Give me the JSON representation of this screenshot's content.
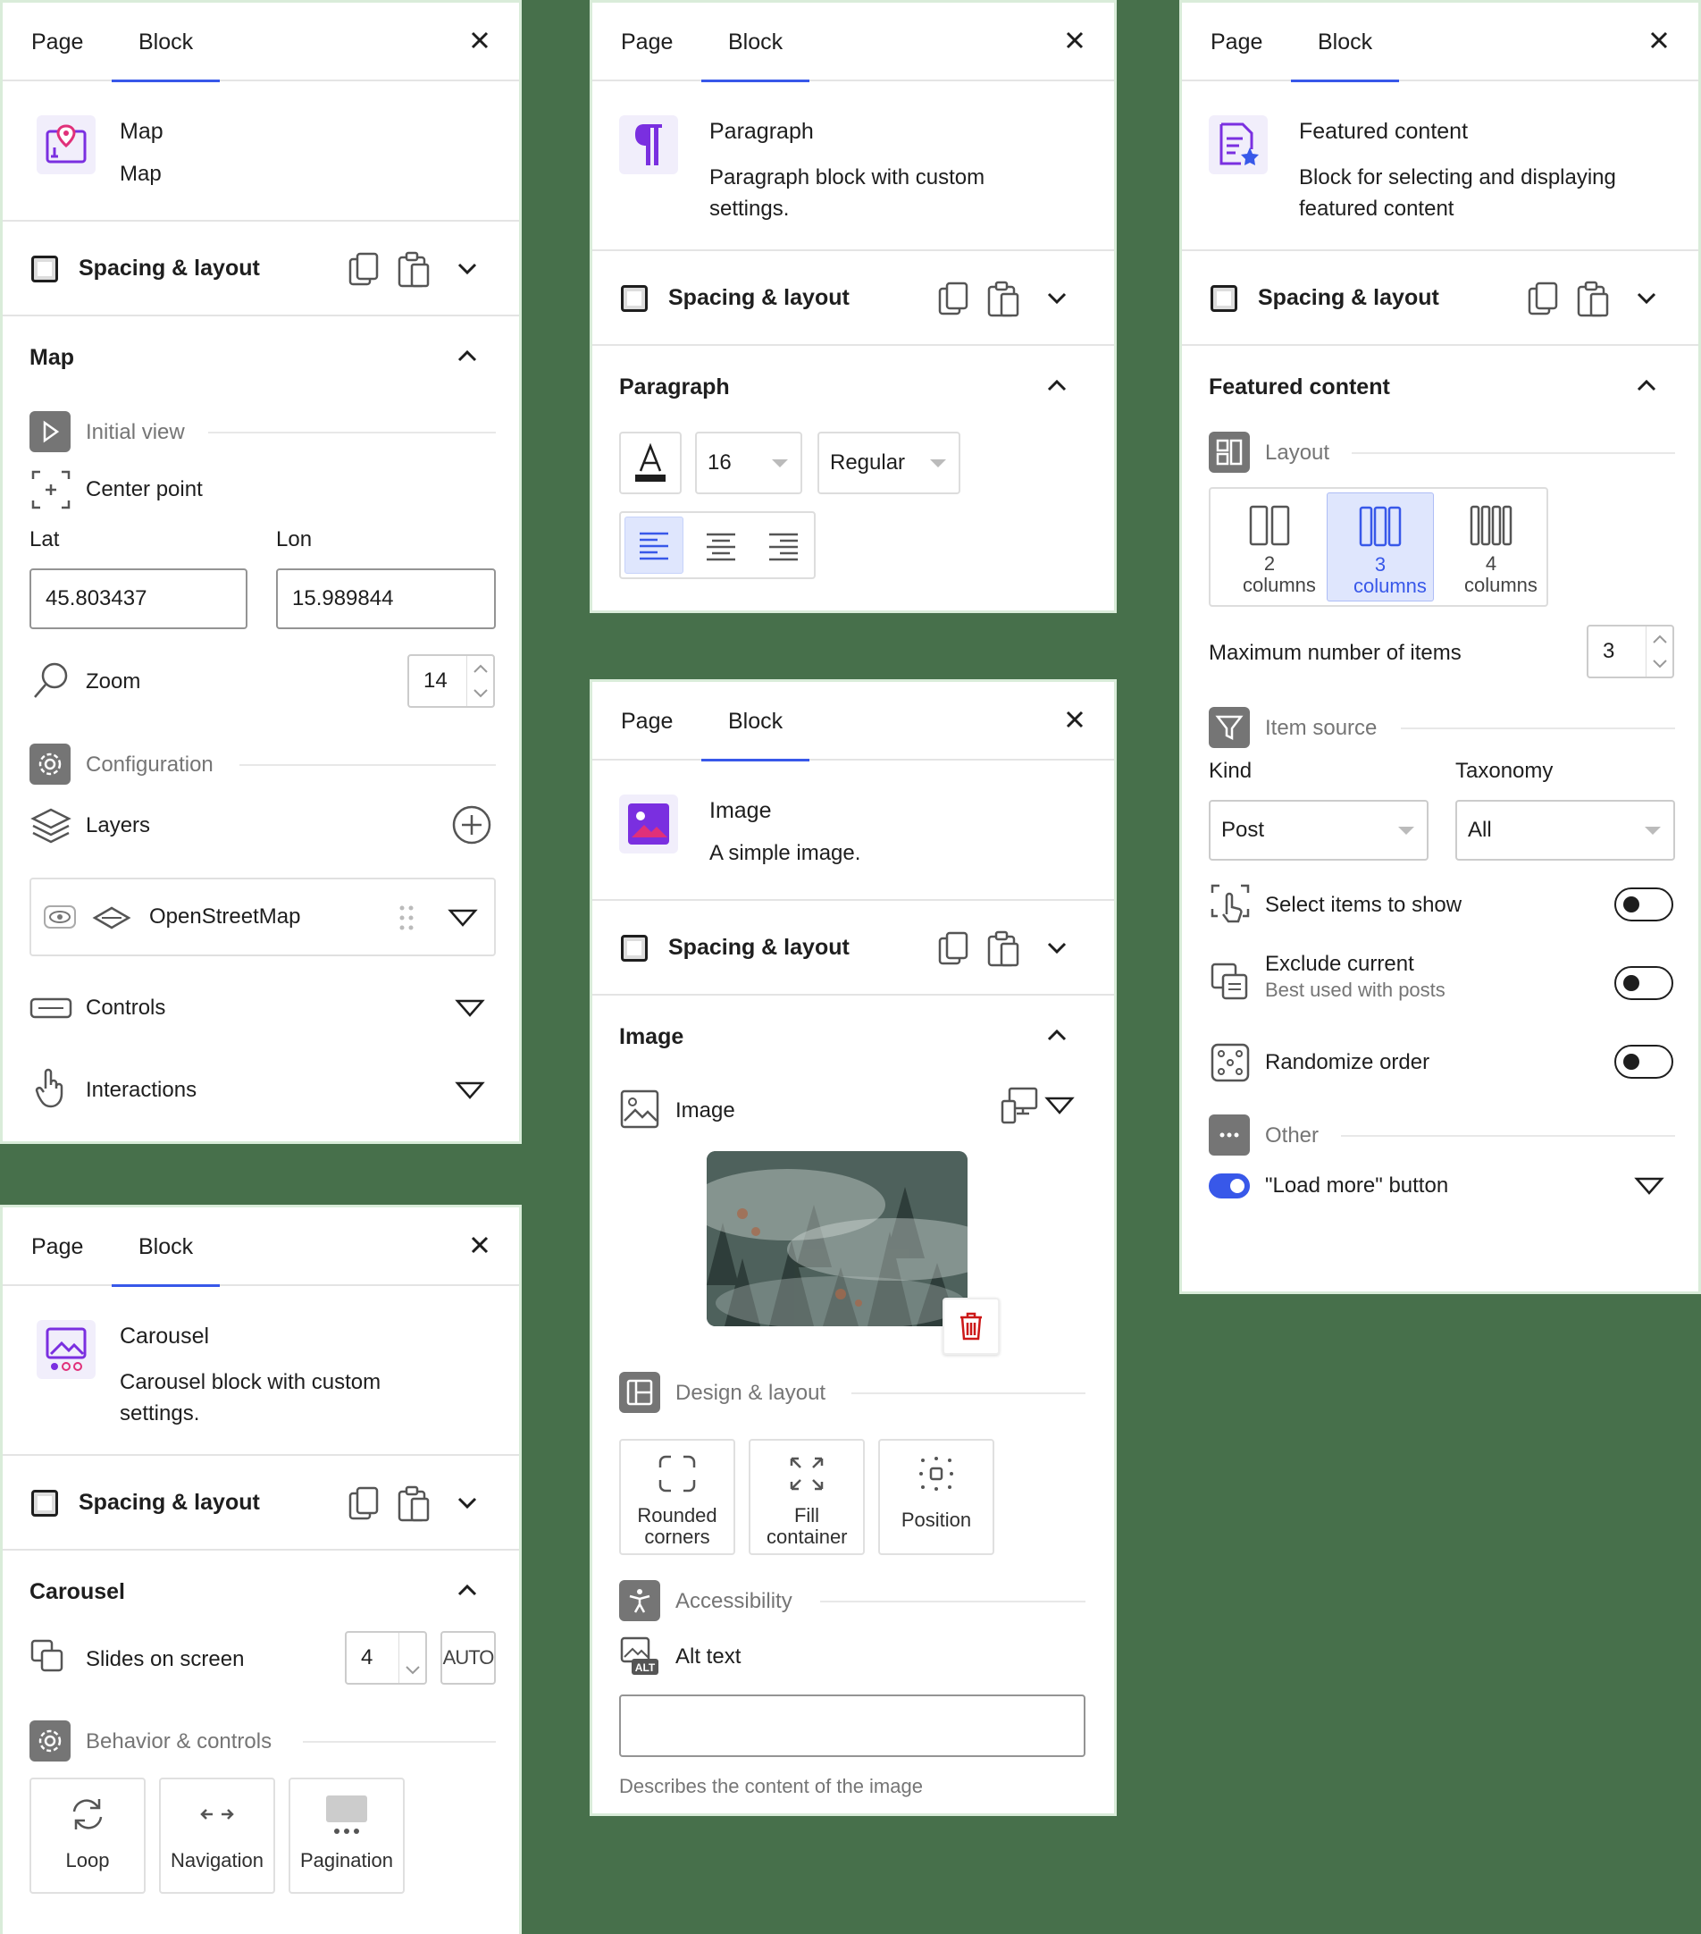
{
  "tabs": {
    "page": "Page",
    "block": "Block"
  },
  "map": {
    "block_title": "Map",
    "block_desc": "Map",
    "spacing": "Spacing & layout",
    "section": "Map",
    "initial_view": "Initial view",
    "center_point": "Center point",
    "lat_label": "Lat",
    "lon_label": "Lon",
    "lat_value": "45.803437",
    "lon_value": "15.989844",
    "zoom_label": "Zoom",
    "zoom_value": "14",
    "configuration": "Configuration",
    "layers": "Layers",
    "layer_name": "OpenStreetMap",
    "controls": "Controls",
    "interactions": "Interactions"
  },
  "carousel": {
    "block_title": "Carousel",
    "block_desc": "Carousel block with custom settings.",
    "spacing": "Spacing & layout",
    "section": "Carousel",
    "slides_label": "Slides on screen",
    "slides_value": "4",
    "auto": "AUTO",
    "behavior": "Behavior & controls",
    "loop": "Loop",
    "navigation": "Navigation",
    "pagination": "Pagination"
  },
  "paragraph": {
    "block_title": "Paragraph",
    "block_desc": "Paragraph block with custom settings.",
    "spacing": "Spacing & layout",
    "section": "Paragraph",
    "font_size": "16",
    "font_weight": "Regular"
  },
  "image": {
    "block_title": "Image",
    "block_desc": "A simple image.",
    "spacing": "Spacing & layout",
    "section": "Image",
    "image_label": "Image",
    "design_layout": "Design & layout",
    "rounded": "Rounded corners",
    "fill": "Fill container",
    "position": "Position",
    "accessibility": "Accessibility",
    "alt_text": "Alt text",
    "alt_value": "",
    "alt_help": "Describes the content of the image"
  },
  "featured": {
    "block_title": "Featured content",
    "block_desc": "Block for selecting and displaying featured content",
    "spacing": "Spacing & layout",
    "section": "Featured content",
    "layout": "Layout",
    "col2": "2 columns",
    "col3": "3 columns",
    "col4": "4 columns",
    "selected_columns": 3,
    "max_items_label": "Maximum number of items",
    "max_items_value": "3",
    "item_source": "Item source",
    "kind_label": "Kind",
    "taxonomy_label": "Taxonomy",
    "kind_value": "Post",
    "taxonomy_value": "All",
    "select_items": "Select items to show",
    "exclude_current": "Exclude current",
    "exclude_help": "Best used with posts",
    "randomize": "Randomize order",
    "other": "Other",
    "load_more": "\"Load more\" button",
    "toggles": {
      "select_items": false,
      "exclude_current": false,
      "randomize": false,
      "load_more": true
    }
  },
  "colors": {
    "accent": "#3858e9",
    "background": "#47704b",
    "block_icon": "#7a2fe0"
  }
}
